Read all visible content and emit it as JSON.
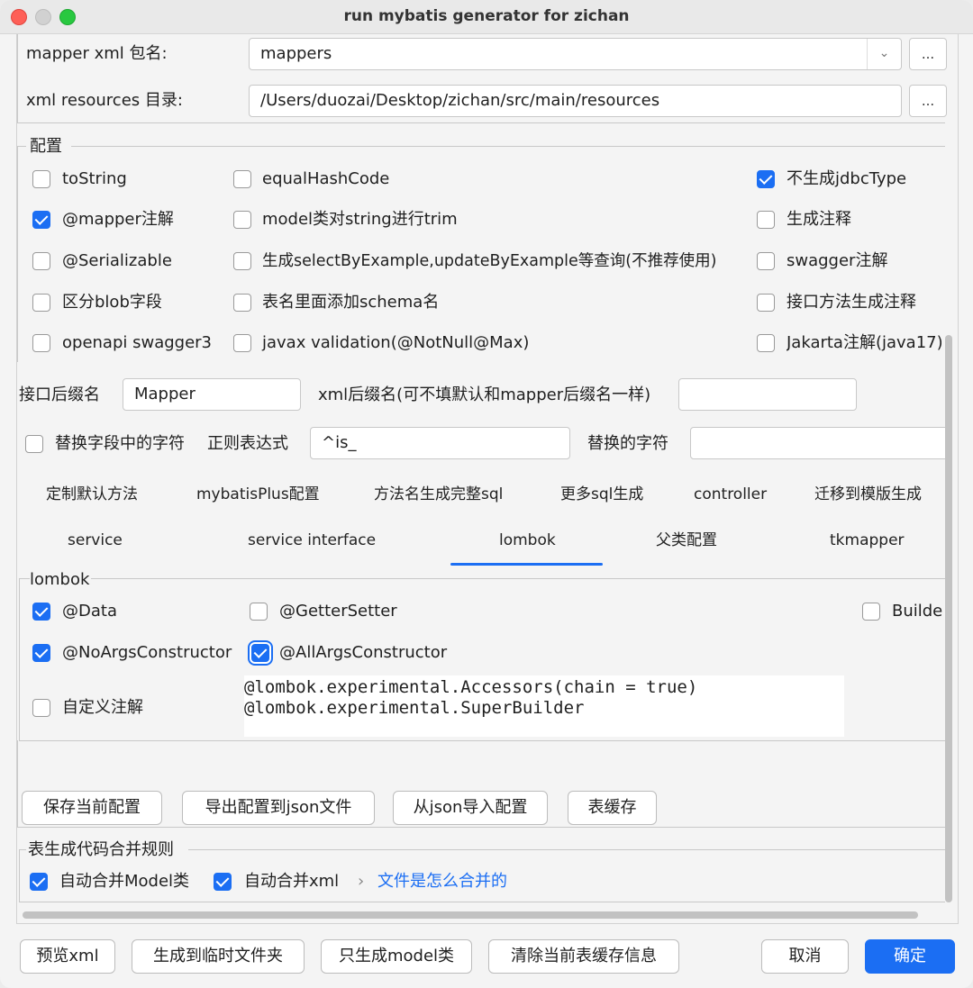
{
  "window": {
    "title": "run mybatis generator for zichan"
  },
  "paths": {
    "mapper_xml_label": "mapper xml 包名:",
    "mapper_xml_value": "mappers",
    "xml_resources_label": "xml resources 目录:",
    "xml_resources_value": "/Users/duozai/Desktop/zichan/src/main/resources",
    "browse_label": "..."
  },
  "config": {
    "legend": "配置",
    "options": [
      {
        "label": "toString",
        "checked": false
      },
      {
        "label": "equalHashCode",
        "checked": false
      },
      {
        "label": "不生成jdbcType",
        "checked": true
      },
      {
        "label": "@mapper注解",
        "checked": true
      },
      {
        "label": "model类对string进行trim",
        "checked": false
      },
      {
        "label": "生成注释",
        "checked": false
      },
      {
        "label": "@Serializable",
        "checked": false
      },
      {
        "label": "生成selectByExample,updateByExample等查询(不推荐使用)",
        "checked": false
      },
      {
        "label": "swagger注解",
        "checked": false
      },
      {
        "label": "区分blob字段",
        "checked": false
      },
      {
        "label": "表名里面添加schema名",
        "checked": false
      },
      {
        "label": "接口方法生成注释",
        "checked": false
      },
      {
        "label": "openapi swagger3",
        "checked": false
      },
      {
        "label": "javax validation(@NotNull@Max)",
        "checked": false
      },
      {
        "label": "Jakarta注解(java17)",
        "checked": false
      }
    ]
  },
  "suffix": {
    "interface_label": "接口后缀名",
    "interface_value": "Mapper",
    "xml_label": "xml后缀名(可不填默认和mapper后缀名一样)",
    "xml_value": ""
  },
  "replace": {
    "checkbox_label": "替换字段中的字符",
    "regex_label": "正则表达式",
    "regex_value": "^is_",
    "replacement_label": "替换的字符",
    "replacement_value": ""
  },
  "tabs": {
    "row1": [
      "定制默认方法",
      "mybatisPlus配置",
      "方法名生成完整sql",
      "更多sql生成",
      "controller",
      "迁移到模版生成"
    ],
    "row2": [
      "service",
      "service interface",
      "lombok",
      "父类配置",
      "tkmapper"
    ],
    "active": "lombok"
  },
  "lombok": {
    "legend": "lombok",
    "options": [
      {
        "label": "@Data",
        "checked": true
      },
      {
        "label": "@GetterSetter",
        "checked": false
      },
      {
        "label": "Builde",
        "checked": false
      },
      {
        "label": "@NoArgsConstructor",
        "checked": true
      },
      {
        "label": "@AllArgsConstructor",
        "checked": true
      },
      {
        "label": "自定义注解",
        "checked": false
      }
    ],
    "custom_annotations": "@lombok.experimental.Accessors(chain = true)\n@lombok.experimental.SuperBuilder"
  },
  "config_buttons": {
    "save": "保存当前配置",
    "export": "导出配置到json文件",
    "import": "从json导入配置",
    "cache": "表缓存"
  },
  "merge": {
    "legend": "表生成代码合并规则",
    "model_label": "自动合并Model类",
    "model_checked": true,
    "xml_label": "自动合并xml",
    "xml_checked": true,
    "chevron": "›",
    "link": "文件是怎么合并的"
  },
  "footer": {
    "preview": "预览xml",
    "gen_temp": "生成到临时文件夹",
    "model_only": "只生成model类",
    "clear_cache": "清除当前表缓存信息",
    "cancel": "取消",
    "ok": "确定"
  },
  "colors": {
    "accent": "#1b6ef3",
    "close": "#fe5f57",
    "zoom": "#28c840"
  }
}
